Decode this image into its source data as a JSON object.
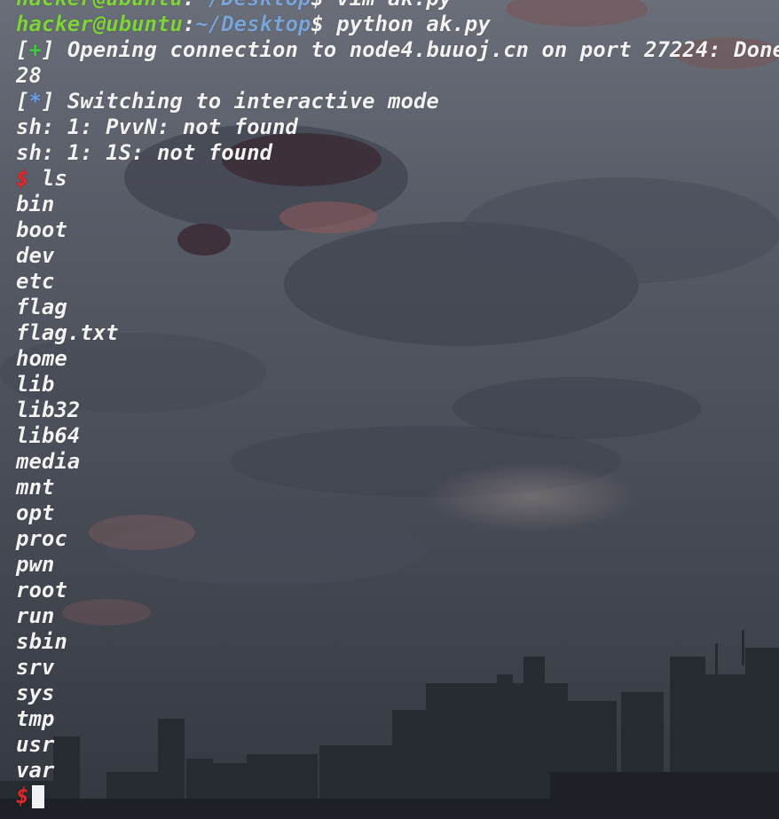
{
  "prompt_lines": [
    {
      "user": "hacker@ubuntu",
      "path": "~/Desktop",
      "command": "vim ak.py"
    },
    {
      "user": "hacker@ubuntu",
      "path": "~/Desktop",
      "command": "python ak.py"
    }
  ],
  "output": {
    "opening_prefix": "+",
    "opening_text": "Opening connection to node4.buuoj.cn on port 27224: Done",
    "number": "28",
    "switch_prefix": "*",
    "switch_text": "Switching to interactive mode",
    "error1": "sh: 1: PvvN: not found",
    "error2": "sh: 1: 1S: not found"
  },
  "shell": {
    "prompt": "$",
    "command": "ls"
  },
  "ls_entries": [
    "bin",
    "boot",
    "dev",
    "etc",
    "flag",
    "flag.txt",
    "home",
    "lib",
    "lib32",
    "lib64",
    "media",
    "mnt",
    "opt",
    "proc",
    "pwn",
    "root",
    "run",
    "sbin",
    "srv",
    "sys",
    "tmp",
    "usr",
    "var"
  ],
  "final_prompt": "$",
  "colors": {
    "user": "#7fd43a",
    "path": "#7aa3d6",
    "prompt": "#e02828",
    "text": "#f2f2f2"
  }
}
